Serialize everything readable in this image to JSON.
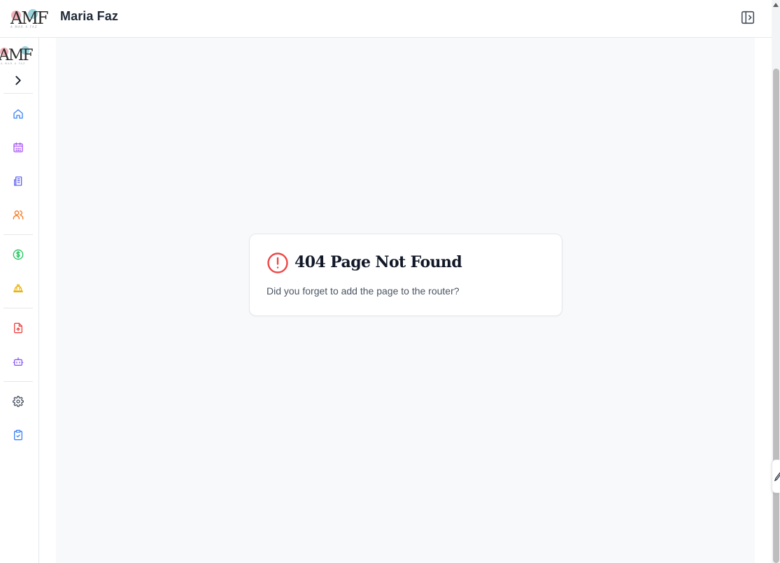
{
  "header": {
    "title": "Maria Faz",
    "logo": {
      "letters": "AMF",
      "tagline": "A MAR A FAZ"
    },
    "panel_toggle_icon": "panel-left-open-icon"
  },
  "sidebar": {
    "expand_icon": "chevron-right-icon",
    "items": [
      {
        "icon": "home-icon",
        "color": "#3b82f6"
      },
      {
        "icon": "calendar-icon",
        "color": "#a855f7"
      },
      {
        "icon": "building-icon",
        "color": "#6366f1"
      },
      {
        "icon": "users-icon",
        "color": "#f97316"
      },
      {
        "icon": "dollar-icon",
        "color": "#22c55e"
      },
      {
        "icon": "hard-hat-icon",
        "color": "#eab308"
      },
      {
        "icon": "file-upload-icon",
        "color": "#ef4444"
      },
      {
        "icon": "bot-icon",
        "color": "#8b5cf6"
      },
      {
        "icon": "settings-icon",
        "color": "#4b5563"
      },
      {
        "icon": "clipboard-check-icon",
        "color": "#3b82f6"
      }
    ]
  },
  "error_card": {
    "icon": "alert-circle-icon",
    "title": "404 Page Not Found",
    "message": "Did you forget to add the page to the router?",
    "icon_color": "#ef4444"
  }
}
